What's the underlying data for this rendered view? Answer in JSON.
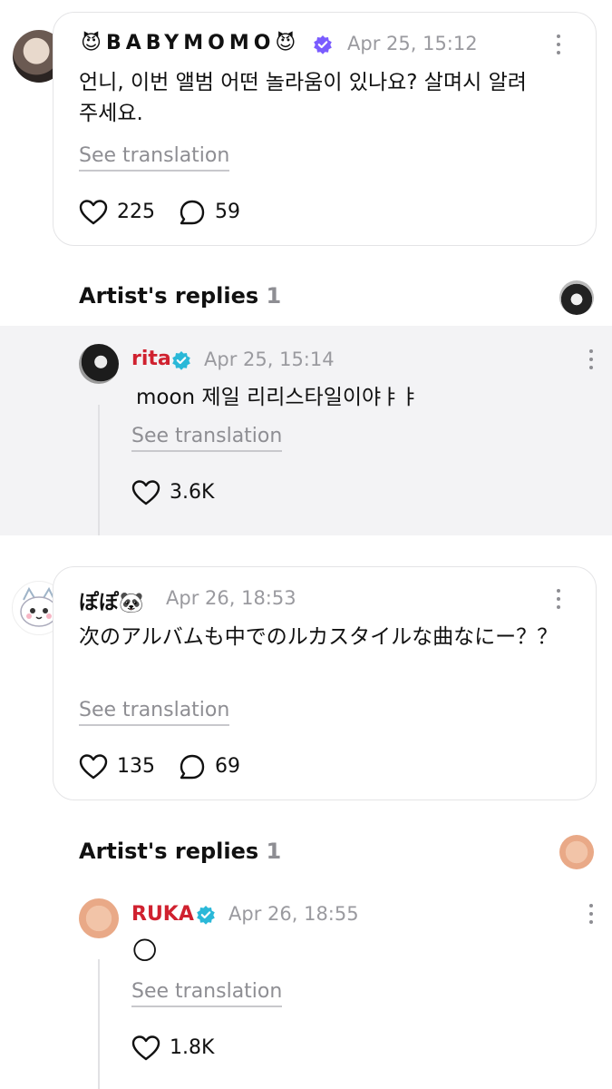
{
  "posts": [
    {
      "user_name": "BABYMOMO",
      "user_prefix_emoji": "😈",
      "user_suffix_emoji": "😈",
      "timestamp": "Apr 25, 15:12",
      "text": "언니, 이번 앨범 어떤 놀라움이 있나요? 살며시 알려 주세요.",
      "translate_label": "See translation",
      "likes": "225",
      "comments": "59",
      "artist_replies": {
        "title": "Artist's replies",
        "count": "1",
        "reply": {
          "user_name": "rita",
          "timestamp": "Apr 25, 15:14",
          "text": "moon 제일 리리스타일이야ㅑㅑ",
          "translate_label": "See translation",
          "likes": "3.6K"
        }
      }
    },
    {
      "user_name": "ぽぽ🐼",
      "timestamp": "Apr 26, 18:53",
      "text": "次のアルバムも中でのルカスタイルな曲なにー？？",
      "translate_label": "See translation",
      "likes": "135",
      "comments": "69",
      "artist_replies": {
        "title": "Artist's replies",
        "count": "1",
        "reply": {
          "user_name": "RUKA",
          "timestamp": "Apr 26, 18:55",
          "text": "🌕",
          "translate_label": "See translation",
          "likes": "1.8K"
        }
      }
    }
  ],
  "icons": {
    "heart": "heart-icon",
    "comment": "comment-bubble-icon",
    "more": "more-options-icon",
    "verified": "verified-badge-icon"
  },
  "colors": {
    "artist_name": "#d0212f",
    "verified_fan": "#7a5cff",
    "verified_artist": "#2ab8d8",
    "muted": "#8e8e93",
    "reply_background": "#f3f3f5",
    "card_border": "#e4e4e6"
  }
}
